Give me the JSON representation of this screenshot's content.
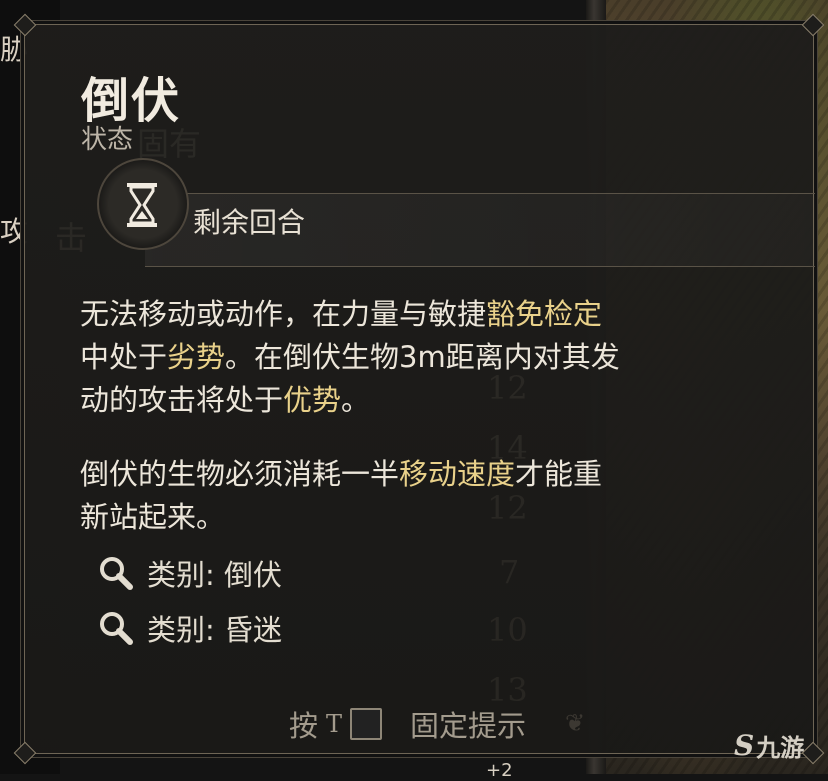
{
  "background": {
    "left_fragments": [
      "胁",
      "攻"
    ],
    "watermark_text": "固有",
    "watermark_attack": "击",
    "faint_numbers": [
      "12",
      "14",
      "12",
      "7",
      "10",
      "13"
    ],
    "bottom_fragment": "+2"
  },
  "tooltip": {
    "title": "倒伏",
    "subtitle": "状态",
    "duration_label": "剩余回合",
    "duration_icon": "hourglass-icon",
    "description": [
      [
        {
          "t": "无法移动或动作，在力量与敏捷"
        },
        {
          "t": "豁免检定",
          "hl": true
        }
      ],
      [
        {
          "t": "中处于"
        },
        {
          "t": "劣势",
          "hl": true
        },
        {
          "t": "。在倒伏生物3m距离内对其发"
        }
      ],
      [
        {
          "t": "动的攻击将处于"
        },
        {
          "t": "优势",
          "hl": true
        },
        {
          "t": "。"
        }
      ]
    ],
    "description2": [
      [
        {
          "t": "倒伏的生物必须消耗一半"
        },
        {
          "t": "移动速度",
          "hl": true
        },
        {
          "t": "才能重"
        }
      ],
      [
        {
          "t": "新站起来。"
        }
      ]
    ],
    "categories": [
      {
        "label": "类别: 倒伏",
        "icon": "search-icon"
      },
      {
        "label": "类别: 昏迷",
        "icon": "search-icon"
      }
    ],
    "hint": {
      "press": "按",
      "key": "T",
      "action": "固定提示"
    }
  },
  "logo": {
    "mark": "S",
    "text": "九游"
  },
  "colors": {
    "highlight": "#e9d18a",
    "text": "#ece6da",
    "panel": "#1e1d1b",
    "border": "#6e6555"
  }
}
